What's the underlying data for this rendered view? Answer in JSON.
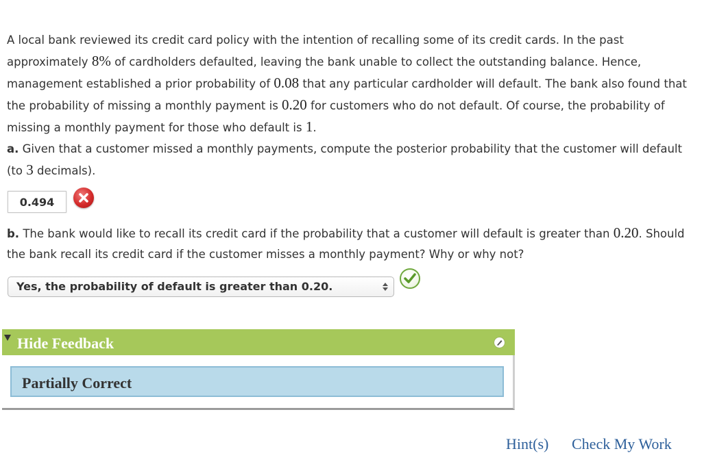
{
  "intro": {
    "t1": "A local bank reviewed its credit card policy with the intention of recalling some of its credit cards. In the past approximately ",
    "v1": "8%",
    "t2": " of cardholders defaulted, leaving the bank unable to collect the outstanding balance. Hence, management established a prior probability of ",
    "v2": "0.08",
    "t3": " that any particular cardholder will default. The bank also found that the probability of missing a monthly payment is ",
    "v3": "0.20",
    "t4": " for customers who do not default. Of course, the probability of missing a monthly payment for those who default is ",
    "v4": "1",
    "t5": "."
  },
  "question_a": {
    "label": "a.",
    "t1": " Given that a customer missed a monthly payments, compute the posterior probability that the customer will default (to ",
    "v1": "3",
    "t2": " decimals).",
    "answer": "0.494",
    "status_icon": "cross-icon"
  },
  "question_b": {
    "label": "b.",
    "t1": " The bank would like to recall its credit card if the probability that a customer will default is greater than ",
    "v1": "0.20",
    "t2": ". Should the bank recall its credit card if the customer misses a monthly payment? Why or why not?",
    "selected_option": "Yes, the probability of default is greater than 0.20.",
    "status_icon": "check-icon"
  },
  "feedback": {
    "toggle_label": "Hide Feedback",
    "result_text": "Partially Correct",
    "header_color": "#a6c85a",
    "body_color": "#b9daea"
  },
  "actions": {
    "hint_label": "Hint(s)",
    "check_label": "Check My Work",
    "link_color": "#2d5f9a"
  }
}
